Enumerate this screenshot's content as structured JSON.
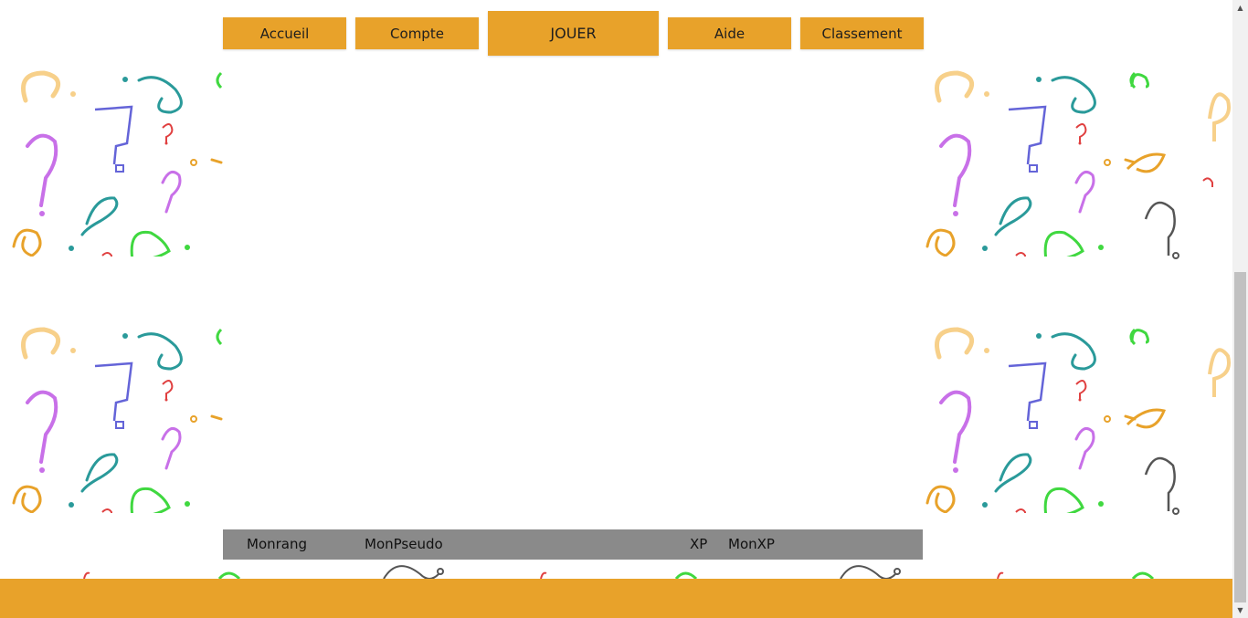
{
  "nav": {
    "items": [
      {
        "label": "Accueil"
      },
      {
        "label": "Compte"
      },
      {
        "label": "JOUER"
      },
      {
        "label": "Aide"
      },
      {
        "label": "Classement"
      }
    ]
  },
  "rank_row": {
    "rank": "Monrang",
    "pseudo": "MonPseudo",
    "xp_label": "XP",
    "xp_value": "MonXP"
  },
  "colors": {
    "accent": "#e8a22a",
    "rank_bar": "#8a8a8a",
    "background": "#ffffff"
  },
  "icons": [
    "question-mark-pattern",
    "scroll-up-icon",
    "scroll-down-icon"
  ]
}
